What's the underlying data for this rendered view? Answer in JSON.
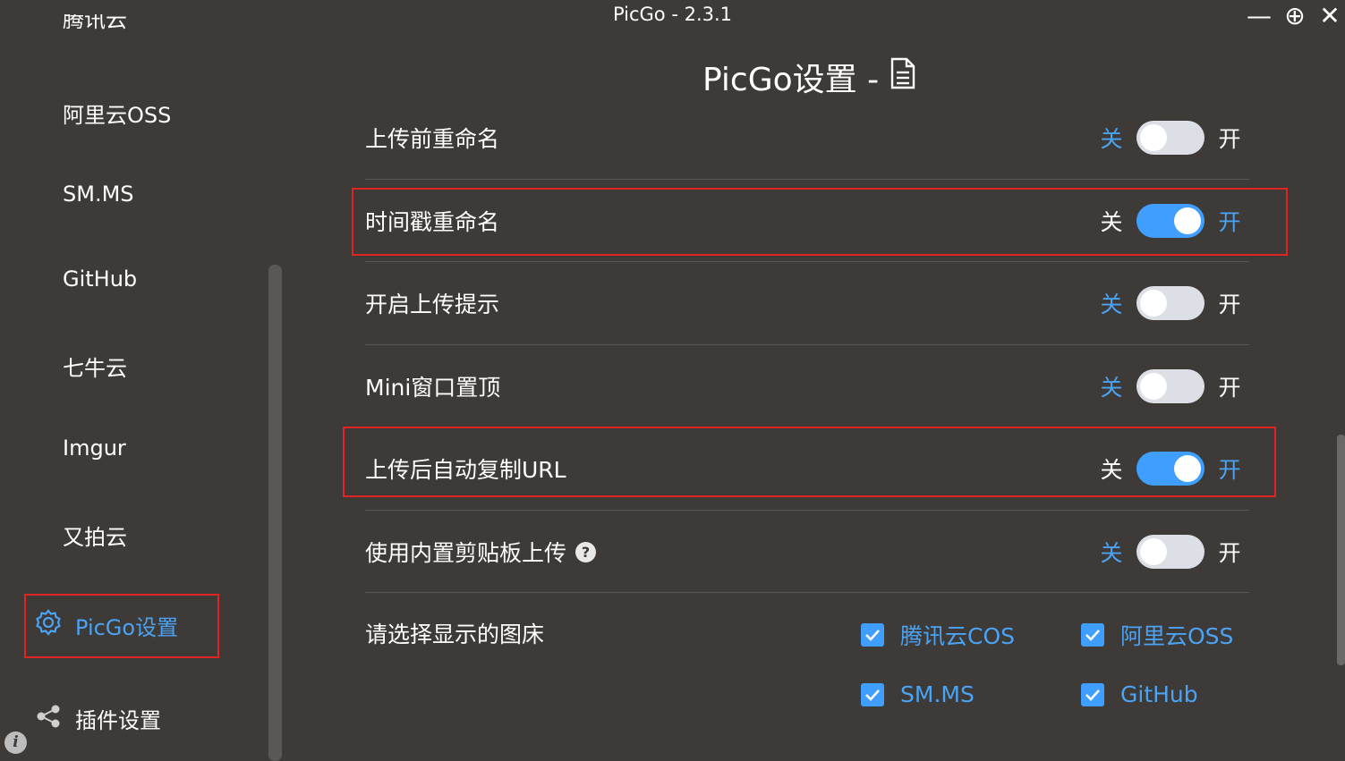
{
  "window": {
    "title": "PicGo - 2.3.1",
    "minimize_glyph": "—",
    "maximize_glyph": "⊕",
    "close_glyph": "✕"
  },
  "sidebar": {
    "partial_item_label": "腾讯云",
    "items": [
      {
        "label": "阿里云OSS"
      },
      {
        "label": "SM.MS"
      },
      {
        "label": "GitHub"
      },
      {
        "label": "七牛云"
      },
      {
        "label": "Imgur"
      },
      {
        "label": "又拍云"
      }
    ],
    "active_item": {
      "label": "PicGo设置",
      "icon": "gear-icon"
    },
    "plugin_item": {
      "label": "插件设置",
      "icon": "share-icon"
    },
    "info_glyph": "i"
  },
  "main": {
    "title": "PicGo设置 -",
    "title_icon": "document-icon",
    "settings": [
      {
        "label": "上传前重命名",
        "off_label": "关",
        "on_label": "开",
        "enabled": false
      },
      {
        "label": "时间戳重命名",
        "off_label": "关",
        "on_label": "开",
        "enabled": true
      },
      {
        "label": "开启上传提示",
        "off_label": "关",
        "on_label": "开",
        "enabled": false
      },
      {
        "label": "Mini窗口置顶",
        "off_label": "关",
        "on_label": "开",
        "enabled": false
      },
      {
        "label": "上传后自动复制URL",
        "off_label": "关",
        "on_label": "开",
        "enabled": true
      },
      {
        "label": "使用内置剪贴板上传",
        "off_label": "关",
        "on_label": "开",
        "enabled": false,
        "help_glyph": "?"
      }
    ],
    "picbed_select": {
      "label": "请选择显示的图床",
      "options": [
        {
          "label": "腾讯云COS",
          "checked": true
        },
        {
          "label": "阿里云OSS",
          "checked": true
        },
        {
          "label": "SM.MS",
          "checked": true
        },
        {
          "label": "GitHub",
          "checked": true
        }
      ]
    }
  },
  "colors": {
    "background": "#3d3a37",
    "accent": "#409eff",
    "accent_text": "#4aa3f5",
    "highlight_border": "#e02424",
    "toggle_off": "#dcdfe6"
  }
}
